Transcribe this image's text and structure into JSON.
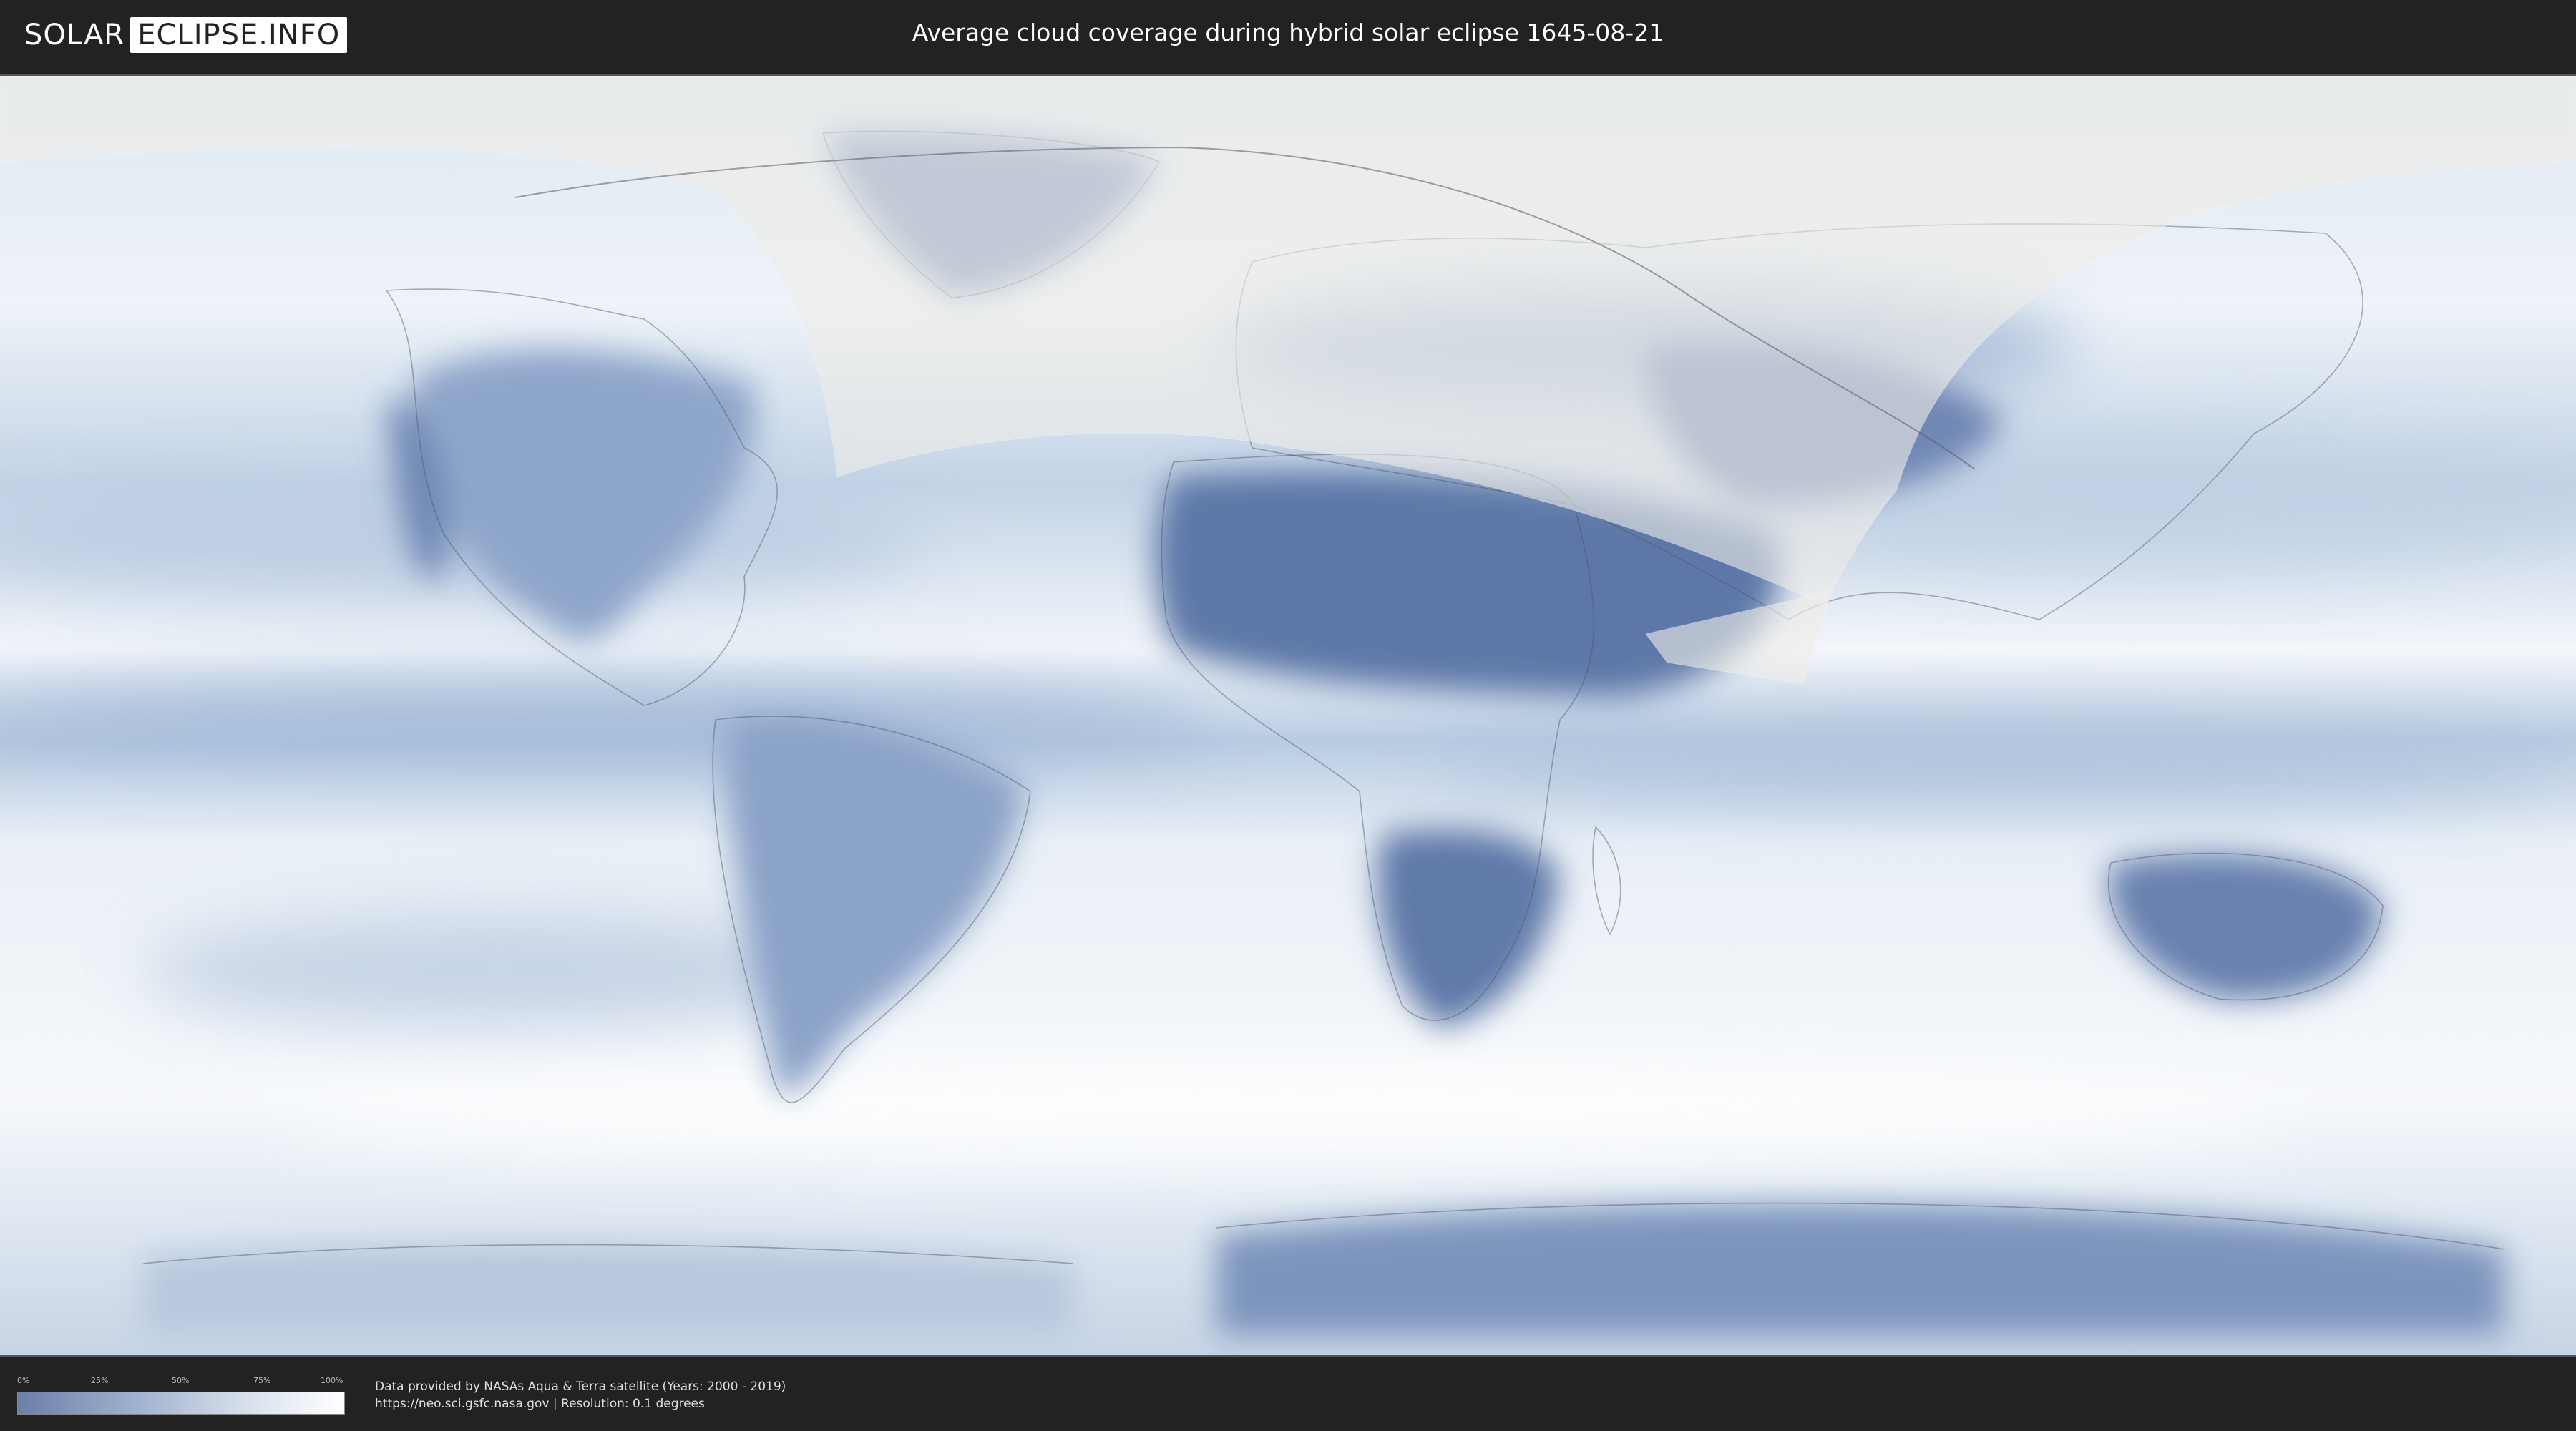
{
  "header": {
    "logo_part1": "SOLAR",
    "logo_part2": "ECLIPSE.INFO",
    "title": "Average cloud coverage during hybrid solar eclipse 1645-08-21"
  },
  "map": {
    "type": "world-cloud-coverage-map",
    "colors": {
      "ocean_cloudy": "#f4f7fb",
      "clear_sky": "#5a74a6",
      "mid": "#a8bdd9",
      "eclipse_zone": "#e9e6e2",
      "border_lines": "#4a5560"
    }
  },
  "legend": {
    "ticks": [
      "0%",
      "25%",
      "50%",
      "75%",
      "100%"
    ],
    "colors": [
      "#6d7ea8",
      "#9fb0cd",
      "#dfe6ef",
      "#ffffff"
    ]
  },
  "credits": {
    "line1": "Data provided by NASAs Aqua & Terra satellite (Years: 2000 - 2019)",
    "line2": "https://neo.sci.gsfc.nasa.gov | Resolution: 0.1 degrees"
  }
}
